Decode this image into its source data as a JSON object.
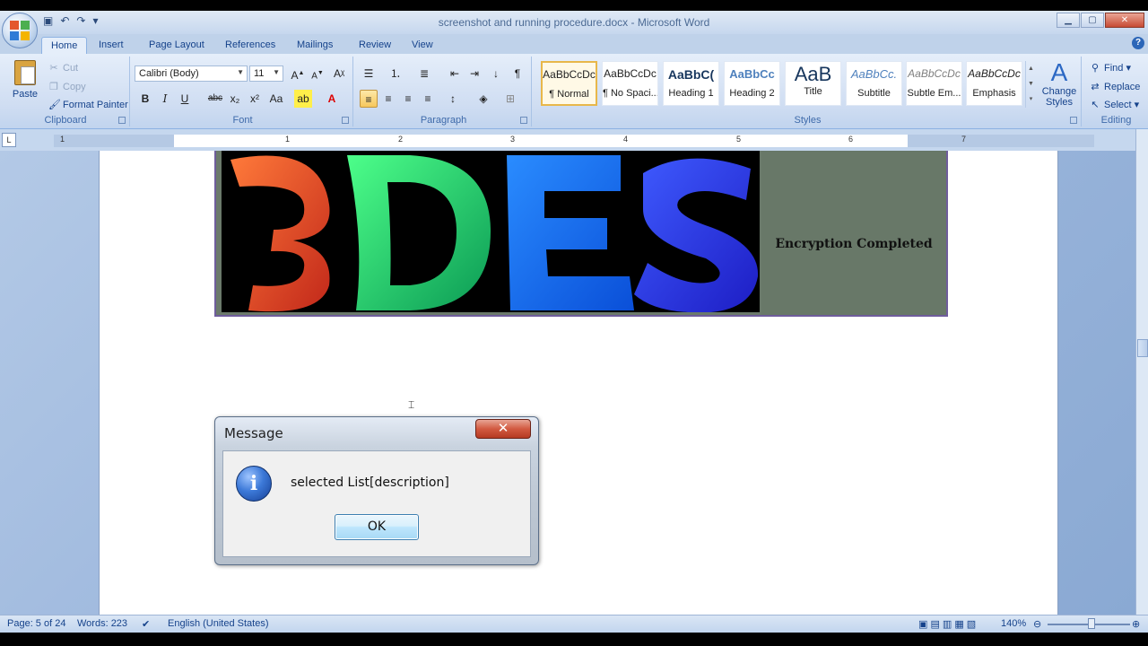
{
  "window": {
    "title": "screenshot and running procedure.docx - Microsoft Word"
  },
  "tabs": [
    "Home",
    "Insert",
    "Page Layout",
    "References",
    "Mailings",
    "Review",
    "View"
  ],
  "ribbon": {
    "clipboard": {
      "label": "Clipboard",
      "paste": "Paste",
      "cut": "Cut",
      "copy": "Copy",
      "format_painter": "Format Painter"
    },
    "font": {
      "label": "Font",
      "font_name": "Calibri (Body)",
      "font_size": "11"
    },
    "paragraph": {
      "label": "Paragraph"
    },
    "styles": {
      "label": "Styles",
      "items": [
        {
          "sample": "AaBbCcDc",
          "name": "¶ Normal"
        },
        {
          "sample": "AaBbCcDc",
          "name": "¶ No Spaci..."
        },
        {
          "sample": "AaBbC(",
          "name": "Heading 1"
        },
        {
          "sample": "AaBbCc",
          "name": "Heading 2"
        },
        {
          "sample": "AaB",
          "name": "Title"
        },
        {
          "sample": "AaBbCc.",
          "name": "Subtitle"
        },
        {
          "sample": "AaBbCcDc",
          "name": "Subtle Em..."
        },
        {
          "sample": "AaBbCcDc",
          "name": "Emphasis"
        }
      ],
      "change_styles": "Change Styles"
    },
    "editing": {
      "label": "Editing",
      "find": "Find",
      "replace": "Replace",
      "select": "Select"
    }
  },
  "ruler": {
    "numbers": [
      "1",
      "1",
      "2",
      "3",
      "4",
      "5",
      "6",
      "7"
    ]
  },
  "document": {
    "banner_text": "Encryption Completed",
    "banner_image_letters": "3DES"
  },
  "dialog": {
    "title": "Message",
    "close_glyph": "✕",
    "message": "selected List[description]",
    "ok_label": "OK"
  },
  "status": {
    "page": "Page: 5 of 24",
    "words": "Words: 223",
    "language": "English (United States)",
    "zoom": "140%"
  },
  "colors": {
    "ribbon_bg": "#dfe9f5",
    "dialog_close": "#c74a33",
    "ok_border": "#3c7fb1"
  }
}
